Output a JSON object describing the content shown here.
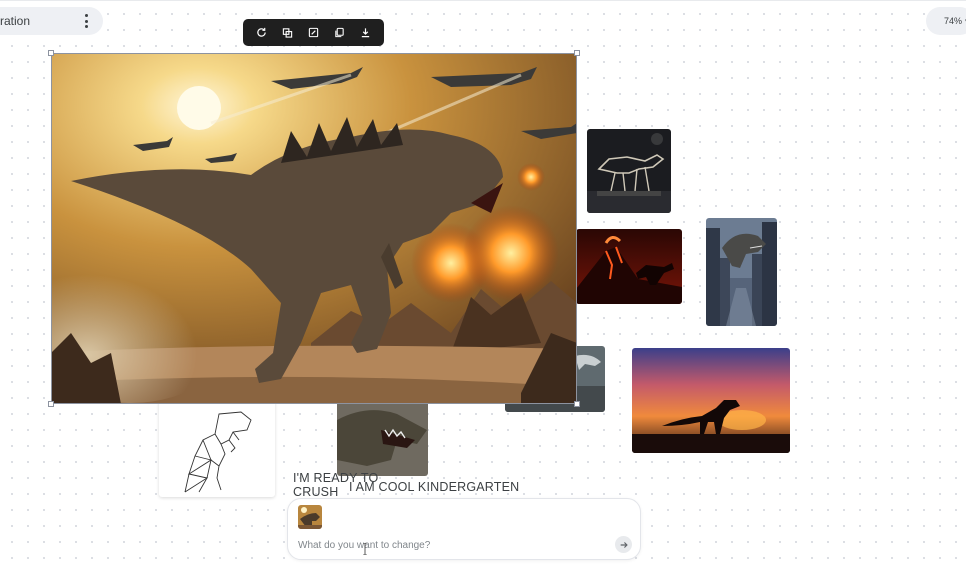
{
  "header": {
    "title": "ration",
    "zoom_label": "74%"
  },
  "toolbar": {
    "buttons": [
      "regenerate-icon",
      "variations-icon",
      "edit-icon",
      "copy-icon",
      "download-icon"
    ]
  },
  "canvas": {
    "captions": {
      "left": "I'M READY TO CRUSH",
      "right": "I AM COOL  KINDERGARTEN"
    }
  },
  "chat": {
    "placeholder": "What do you want to change?"
  },
  "colors": {
    "toolbar_bg": "#1f1f1f",
    "pill_bg": "#eef0f4",
    "selection": "#8d93a0"
  }
}
